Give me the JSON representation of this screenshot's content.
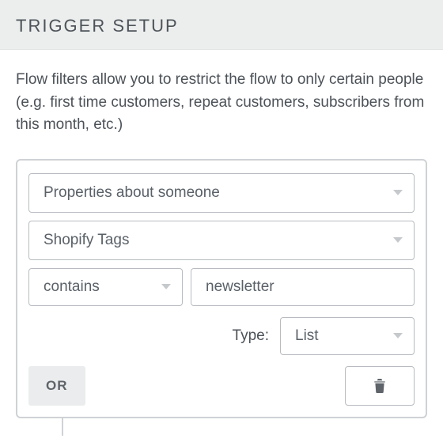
{
  "header": {
    "title": "TRIGGER SETUP"
  },
  "description": "Flow filters allow you to restrict the flow to only certain people (e.g. first time customers, repeat customers, subscribers from this month, etc.)",
  "filter": {
    "subject": "Properties about someone",
    "property": "Shopify Tags",
    "operator": "contains",
    "value": "newsletter",
    "type_label": "Type:",
    "type_value": "List"
  },
  "actions": {
    "or_label": "OR"
  },
  "icons": {
    "chevron_down": "chevron-down-icon",
    "trash": "trash-icon"
  }
}
